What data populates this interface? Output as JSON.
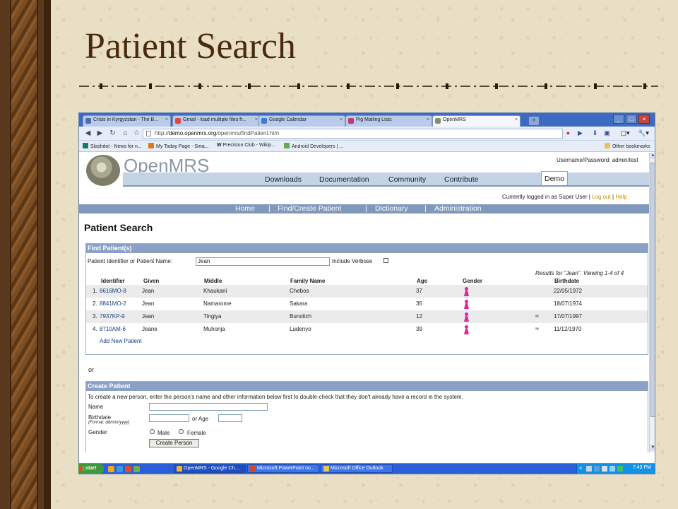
{
  "slide": {
    "title": "Patient Search"
  },
  "browser": {
    "tabs": [
      {
        "label": "Crisis in Kyrgyzstan - The B...",
        "active": false
      },
      {
        "label": "Gmail - load multiple files fr...",
        "active": false
      },
      {
        "label": "Google Calendar",
        "active": false
      },
      {
        "label": "Pig Mailing Lists",
        "active": false
      },
      {
        "label": "OpenMRS",
        "active": true
      }
    ],
    "new_tab": "+",
    "window_buttons": {
      "min": "_",
      "max": "□",
      "close": "×"
    },
    "nav": {
      "back": "◀",
      "forward": "▶",
      "reload": "↻",
      "home": "⌂",
      "star": "☆"
    },
    "url": {
      "scheme": "http://",
      "host": "demo.openmrs.org",
      "path": "/openmrs/findPatient.htm"
    },
    "url_icons": {
      "stop": "●",
      "go": "▶",
      "download": "⬇",
      "bookmark": "▣",
      "page_menu": "▢▾",
      "tools_menu": "🔧▾"
    },
    "bookmarks": [
      {
        "label": "Slashdot - News for n...",
        "icon_color": "#1a7a6a"
      },
      {
        "label": "My Today Page - Sma...",
        "icon_color": "#e0781a"
      },
      {
        "label": "Precision Club - Wikip...",
        "icon_color": "#333333"
      },
      {
        "label": "Android Developers | ...",
        "icon_color": "#6aa84f"
      }
    ],
    "other_bookmarks": "Other bookmarks",
    "other_bookmarks_icon_color": "#e8c25a",
    "bookmark_prefix": "W"
  },
  "openmrs": {
    "logo": "OpenMRS",
    "userpass": "Username/Password: admin/test",
    "menu": [
      "Downloads",
      "Documentation",
      "Community",
      "Contribute"
    ],
    "menu_active": "Demo",
    "logged_in": "Currently logged in as Super User",
    "logout": "Log out",
    "help": "Help",
    "separator": "|",
    "main_nav": [
      "Home",
      "Find/Create Patient",
      "Dictionary",
      "Administration"
    ],
    "page_title": "Patient Search",
    "find": {
      "header": "Find Patient(s)",
      "label": "Patient Identifier or Patient Name:",
      "value": "Jean",
      "verbose_label": "Include Verbose",
      "results": "Results for \"Jean\".  Viewing 1-4 of 4",
      "columns": [
        "Identifier",
        "Given",
        "Middle",
        "Family Name",
        "Age",
        "Gender",
        "Birthdate"
      ],
      "rows": [
        {
          "num": "1.",
          "id": "8616MO-8",
          "given": "Jean",
          "middle": "Khaukani",
          "family": "Chebos",
          "age": "37",
          "gender": "female",
          "estimated": "",
          "birthdate": "22/05/1972"
        },
        {
          "num": "2.",
          "id": "8841MO-2",
          "given": "Jean",
          "middle": "Namarome",
          "family": "Sakara",
          "age": "35",
          "gender": "female",
          "estimated": "",
          "birthdate": "18/07/1974"
        },
        {
          "num": "3.",
          "id": "7937KP-9",
          "given": "Jean",
          "middle": "Tingiya",
          "family": "Bunotich",
          "age": "12",
          "gender": "female",
          "estimated": "≈",
          "birthdate": "17/07/1997"
        },
        {
          "num": "4.",
          "id": "8710AM-6",
          "given": "Jeane",
          "middle": "Muhonja",
          "family": "Ludenyo",
          "age": "39",
          "gender": "female",
          "estimated": "≈",
          "birthdate": "11/12/1970"
        }
      ],
      "add_new": "Add New Patient"
    },
    "or": "or",
    "create": {
      "header": "Create Patient",
      "intro": "To create a new person, enter the person's name and other information below first to double-check that they don't already have a record in the system.",
      "name_label": "Name",
      "name_value": "",
      "birthdate_label": "Birthdate",
      "birthdate_format": "(Format: dd/mm/yyyy)",
      "birthdate_value": "",
      "or_age": "or Age",
      "age_value": "",
      "gender_label": "Gender",
      "male": "Male",
      "female": "Female",
      "button": "Create Person"
    }
  },
  "taskbar": {
    "start": "start",
    "quick_launch_colors": [
      "#f3a51b",
      "#3a9adb",
      "#e34a1f",
      "#6fb04a"
    ],
    "tasks": [
      {
        "label": "OpenMRS - Google Ch...",
        "active": true,
        "icon_color": "#e8b53a"
      },
      {
        "label": "Microsoft PowerPoint no...",
        "active": false,
        "icon_color": "#d24726"
      },
      {
        "label": "Microsoft Office Outlook",
        "active": false,
        "icon_color": "#e8c25a"
      }
    ],
    "tray_expand": "«",
    "tray_icon_colors": [
      "#d0d0d0",
      "#5aa0e0",
      "#e0e0e0",
      "#9ad0f0",
      "#40c060"
    ],
    "clock": "7:43 PM"
  }
}
